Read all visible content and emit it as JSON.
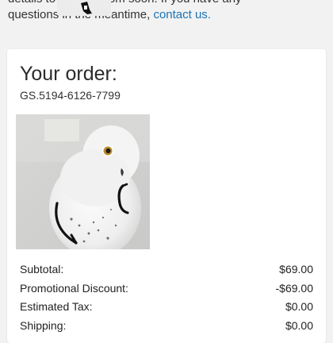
{
  "intro": {
    "line1": "details to                  @gmail.com soon. If you have any",
    "line2_prefix": "questions in the meantime, ",
    "contact_link": "contact us."
  },
  "order": {
    "title": "Your order:",
    "number": "GS.5194-6126-7799",
    "image_icon": "owl-photo"
  },
  "totals": [
    {
      "label": "Subtotal:",
      "value": "$69.00"
    },
    {
      "label": "Promotional Discount:",
      "value": "-$69.00"
    },
    {
      "label": "Estimated Tax:",
      "value": "$0.00"
    },
    {
      "label": "Shipping:",
      "value": "$0.00"
    }
  ],
  "colors": {
    "link": "#1a73b8",
    "background": "#f2f2f2",
    "card": "#ffffff"
  }
}
